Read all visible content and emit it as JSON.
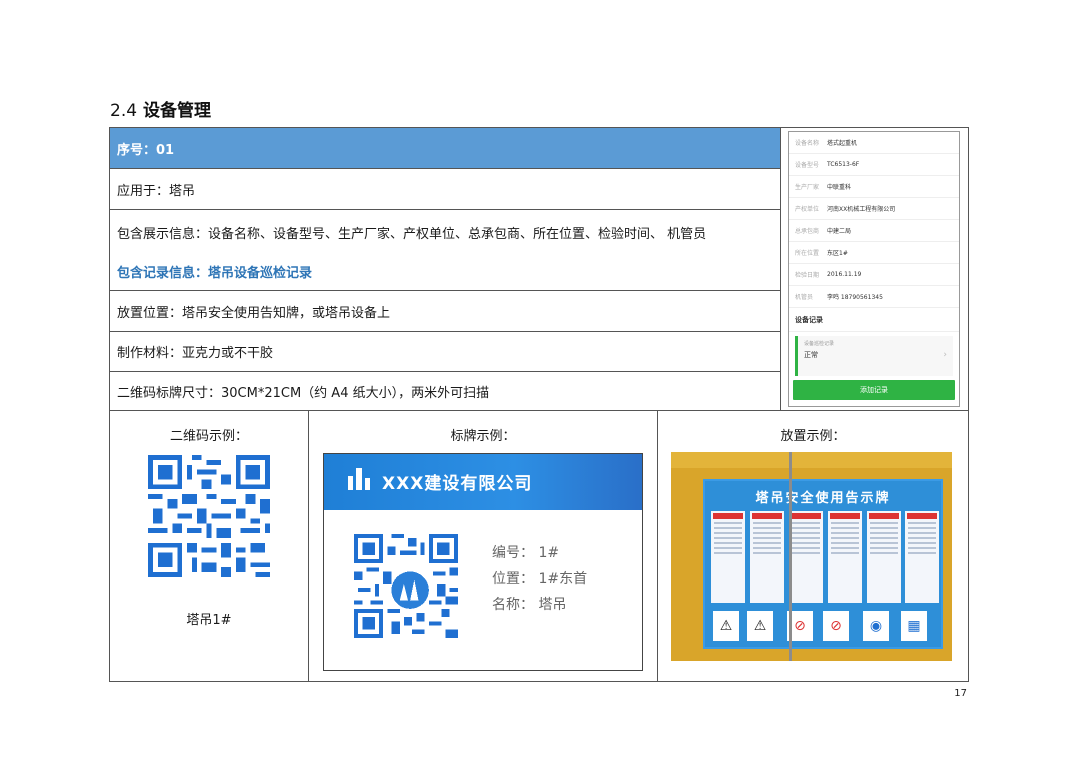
{
  "section": {
    "number": "2.4",
    "title": "设备管理"
  },
  "rows": {
    "serial": "序号：01",
    "applies": "应用于：塔吊",
    "display_info": "包含展示信息：设备名称、设备型号、生产厂家、产权单位、总承包商、所在位置、检验时间、 机管员",
    "record_info": "包含记录信息：塔吊设备巡检记录",
    "placement": "放置位置：塔吊安全使用告知牌，或塔吊设备上",
    "material": "制作材料：亚克力或不干胶",
    "size": "二维码标牌尺寸：30CM*21CM（约 A4 纸大小），两米外可扫描"
  },
  "phone": {
    "fields": [
      {
        "label": "设备名称",
        "value": "塔式起重机"
      },
      {
        "label": "设备型号",
        "value": "TC6513-6F"
      },
      {
        "label": "生产厂家",
        "value": "中联重科"
      },
      {
        "label": "产权单位",
        "value": "河南XX机械工程有限公司"
      },
      {
        "label": "总承包商",
        "value": "中建二局"
      },
      {
        "label": "所在位置",
        "value": "东区1#"
      },
      {
        "label": "检验日期",
        "value": "2016.11.19"
      },
      {
        "label": "机管员",
        "value": "李鸣 18790561345"
      }
    ],
    "records_heading": "设备记录",
    "record_title": "设备巡检记录",
    "record_status": "正常",
    "add_button": "添加记录"
  },
  "bottom": {
    "qr_title": "二维码示例：",
    "qr_caption": "塔吊1#",
    "sign_title": "标牌示例：",
    "sign": {
      "company": "XXX建设有限公司",
      "number": "编号： 1#",
      "position": "位置： 1#东首",
      "name": "名称： 塔吊"
    },
    "placement_title": "放置示例：",
    "board_title": "塔吊安全使用告示牌"
  },
  "page_number": "17",
  "colors": {
    "header_blue": "#5b9bd5",
    "record_blue": "#2e75b6",
    "sign_blue": "#1f7fd6",
    "green": "#2fb344"
  }
}
